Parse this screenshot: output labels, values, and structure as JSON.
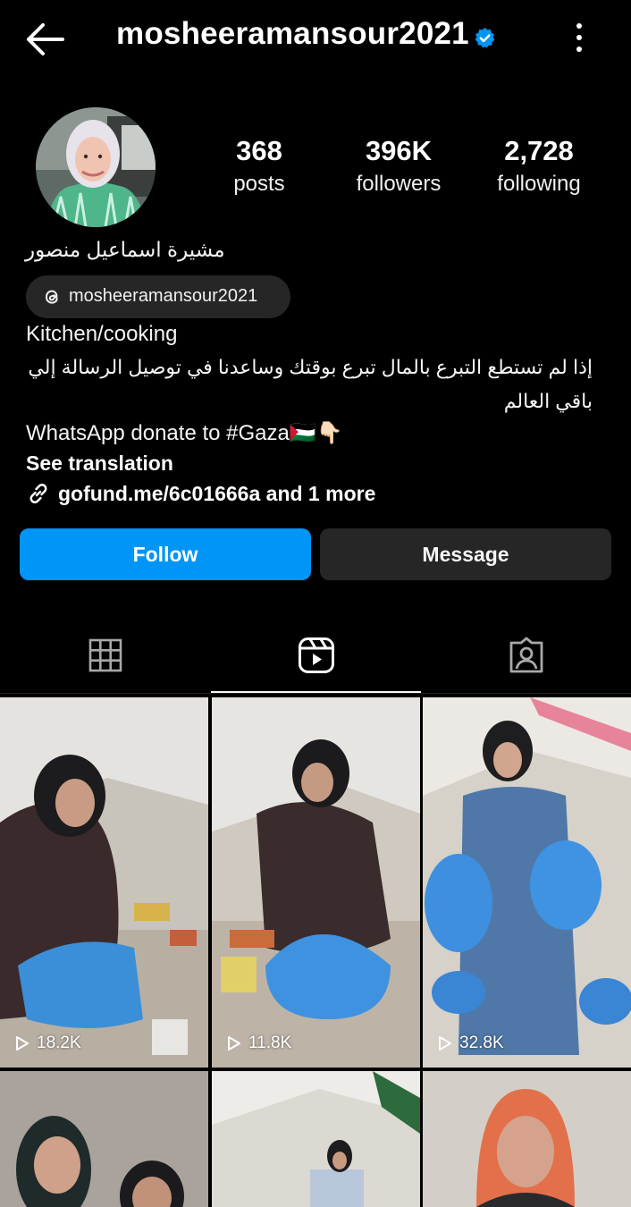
{
  "header": {
    "username": "mosheeramansour2021",
    "verified": true,
    "back_icon": "arrow-left-icon",
    "more_icon": "vertical-dots-icon"
  },
  "profile": {
    "stats": [
      {
        "value": "368",
        "label": "posts"
      },
      {
        "value": "396K",
        "label": "followers"
      },
      {
        "value": "2,728",
        "label": "following"
      }
    ],
    "display_name": "مشيرة  اسماعيل منصور",
    "threads_handle": "mosheeramansour2021",
    "category": "Kitchen/cooking",
    "bio_arabic": "إذا لم تستطع التبرع بالمال تبرع بوقتك وساعدنا في توصيل الرسالة إلي باقي العالم",
    "bio_whatsapp": "WhatsApp donate to #Gaza🇵🇸👇🏻",
    "see_translation": "See translation",
    "link_text": "gofund.me/6c01666a and 1 more"
  },
  "actions": {
    "follow_label": "Follow",
    "message_label": "Message"
  },
  "tabs": [
    {
      "icon": "grid-icon",
      "active": false
    },
    {
      "icon": "reels-icon",
      "active": true
    },
    {
      "icon": "tagged-icon",
      "active": false
    }
  ],
  "reels": [
    {
      "views": "18.2K"
    },
    {
      "views": "11.8K"
    },
    {
      "views": "32.8K"
    },
    {
      "views": ""
    },
    {
      "views": ""
    },
    {
      "views": ""
    }
  ],
  "colors": {
    "background": "#000000",
    "follow_button": "#0095f6",
    "secondary_button": "#262626",
    "verified_badge": "#0095f6"
  }
}
